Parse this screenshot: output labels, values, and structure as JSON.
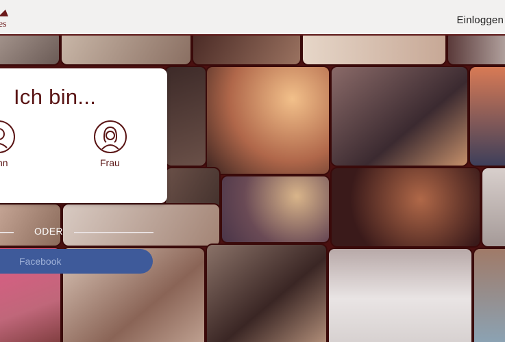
{
  "header": {
    "logo_text": "tes",
    "login_label": "Einloggen"
  },
  "card": {
    "title": "Ich bin...",
    "options": [
      {
        "label": "nn",
        "icon": "man-icon"
      },
      {
        "label": "Frau",
        "icon": "woman-icon"
      }
    ]
  },
  "divider_text": "ODER",
  "facebook_label": "Facebook",
  "colors": {
    "brand": "#5a1515",
    "facebook": "#3e5a9a",
    "header_bg": "#f2f1f0"
  }
}
